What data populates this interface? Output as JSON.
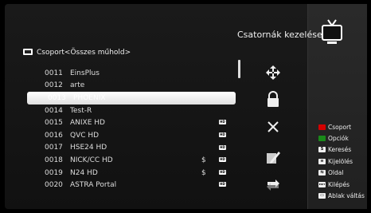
{
  "header": {
    "title": "Csatornák kezelése"
  },
  "group": {
    "label": "Csoport<Összes műhold>"
  },
  "channels": [
    {
      "num": "0011",
      "name": "EinsPlus",
      "dollar": "",
      "hd": false,
      "selected": false
    },
    {
      "num": "0012",
      "name": "arte",
      "dollar": "",
      "hd": false,
      "selected": false
    },
    {
      "num": "0013",
      "name": "PHOENIX",
      "dollar": "",
      "hd": false,
      "selected": true
    },
    {
      "num": "0014",
      "name": "Test-R",
      "dollar": "",
      "hd": false,
      "selected": false
    },
    {
      "num": "0015",
      "name": "ANIXE HD",
      "dollar": "",
      "hd": true,
      "selected": false
    },
    {
      "num": "0016",
      "name": "QVC HD",
      "dollar": "",
      "hd": true,
      "selected": false
    },
    {
      "num": "0017",
      "name": "HSE24 HD",
      "dollar": "",
      "hd": true,
      "selected": false
    },
    {
      "num": "0018",
      "name": "NICK/CC HD",
      "dollar": "$",
      "hd": true,
      "selected": false
    },
    {
      "num": "0019",
      "name": "N24 HD",
      "dollar": "$",
      "hd": true,
      "selected": false
    },
    {
      "num": "0020",
      "name": "ASTRA Portal",
      "dollar": "",
      "hd": true,
      "selected": false
    }
  ],
  "hd_label": "HD",
  "legend": [
    {
      "badge": "",
      "label": "Csoport",
      "color": "#d40000"
    },
    {
      "badge": "",
      "label": "Opciók",
      "color": "#1a8a1a"
    },
    {
      "badge": "S",
      "label": "Keresés",
      "color": "#f0f0f0"
    },
    {
      "badge": "≡",
      "label": "Kijelölés",
      "color": "#f0f0f0"
    },
    {
      "badge": "⇆",
      "label": "Oldal",
      "color": "#f0f0f0"
    },
    {
      "badge": "EXIT",
      "label": "Kilépés",
      "color": "#f0f0f0"
    },
    {
      "badge": "▭",
      "label": "Ablak váltás",
      "color": "#f0f0f0"
    }
  ]
}
